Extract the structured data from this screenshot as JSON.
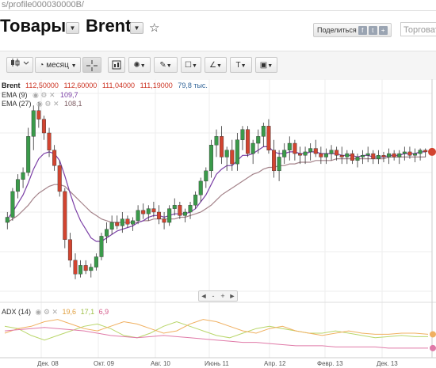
{
  "url": "s/profile000030000B/",
  "header": {
    "section_title": "Товары",
    "instrument": "Brent",
    "share_label": "Поделиться",
    "share_icons": [
      "f",
      "t",
      "+"
    ],
    "search_placeholder": "Торговать"
  },
  "toolbar": {
    "period_label": "месяц",
    "buttons": [
      {
        "name": "chart-type-button",
        "icon": "candles-icon"
      },
      {
        "name": "period-button",
        "icon": "clock-icon"
      },
      {
        "name": "crosshair-button",
        "icon": "crosshair-icon"
      },
      {
        "name": "frame-button",
        "icon": "frame-icon"
      },
      {
        "name": "indicators-button",
        "icon": "sun-icon"
      },
      {
        "name": "draw-line-button",
        "icon": "pencil-icon"
      },
      {
        "name": "shapes-button",
        "icon": "square-icon"
      },
      {
        "name": "fibonacci-button",
        "icon": "angle-icon"
      },
      {
        "name": "text-button",
        "icon": "text-icon"
      },
      {
        "name": "image-button",
        "icon": "image-icon"
      }
    ],
    "text_tool_glyph": "T"
  },
  "legend": {
    "instrument": "Brent",
    "open": "112,50000",
    "high": "112,60000",
    "low": "111,04000",
    "close": "111,19000",
    "volume": "79,8 тыс.",
    "ema1_label": "EMA (9)",
    "ema1_value": "109,7",
    "ema2_label": "EMA (27)",
    "ema2_value": "108,1"
  },
  "adx": {
    "label": "ADX (14)",
    "v1": "19,6",
    "v2": "17,1",
    "v3": "6,9"
  },
  "nav": [
    "◄",
    "-",
    "+",
    "►"
  ],
  "x_axis_labels": [
    "Дек. 08",
    "Окт. 09",
    "Авг. 10",
    "Июнь 11",
    "Апр. 12",
    "Февр. 13",
    "Дек. 13"
  ],
  "colors": {
    "up": "#3a9a4a",
    "down": "#d24430",
    "ema9": "#7b3fa6",
    "ema27": "#a4838a",
    "adx": "#e07aa8",
    "di_plus": "#f0b060",
    "di_minus": "#b9d66a",
    "legend_red": "#cc3322",
    "legend_blue": "#336699"
  },
  "chart_data": {
    "type": "candlestick",
    "title": "Brent",
    "xlabel": "",
    "ylabel": "",
    "candles": [
      [
        70,
        76,
        66,
        73
      ],
      [
        73,
        90,
        71,
        88
      ],
      [
        88,
        98,
        84,
        95
      ],
      [
        95,
        102,
        90,
        99
      ],
      [
        99,
        125,
        97,
        120
      ],
      [
        120,
        138,
        112,
        135
      ],
      [
        135,
        140,
        125,
        130
      ],
      [
        130,
        132,
        118,
        122
      ],
      [
        122,
        125,
        108,
        112
      ],
      [
        112,
        115,
        100,
        103
      ],
      [
        103,
        106,
        85,
        88
      ],
      [
        88,
        90,
        55,
        60
      ],
      [
        60,
        64,
        44,
        48
      ],
      [
        48,
        52,
        37,
        40
      ],
      [
        40,
        48,
        38,
        45
      ],
      [
        45,
        48,
        40,
        42
      ],
      [
        42,
        46,
        38,
        44
      ],
      [
        44,
        52,
        42,
        50
      ],
      [
        50,
        64,
        48,
        62
      ],
      [
        62,
        70,
        58,
        66
      ],
      [
        66,
        74,
        63,
        70
      ],
      [
        70,
        74,
        66,
        68
      ],
      [
        68,
        76,
        64,
        72
      ],
      [
        72,
        74,
        67,
        69
      ],
      [
        69,
        73,
        65,
        71
      ],
      [
        71,
        80,
        69,
        77
      ],
      [
        77,
        81,
        72,
        75
      ],
      [
        75,
        80,
        71,
        78
      ],
      [
        78,
        82,
        73,
        76
      ],
      [
        76,
        80,
        69,
        72
      ],
      [
        72,
        76,
        66,
        70
      ],
      [
        70,
        80,
        68,
        78
      ],
      [
        78,
        84,
        74,
        80
      ],
      [
        80,
        82,
        72,
        74
      ],
      [
        74,
        78,
        70,
        76
      ],
      [
        76,
        82,
        72,
        80
      ],
      [
        80,
        88,
        78,
        86
      ],
      [
        86,
        96,
        82,
        94
      ],
      [
        94,
        102,
        90,
        100
      ],
      [
        100,
        118,
        96,
        115
      ],
      [
        115,
        124,
        108,
        120
      ],
      [
        120,
        126,
        104,
        108
      ],
      [
        108,
        114,
        100,
        112
      ],
      [
        112,
        118,
        100,
        104
      ],
      [
        104,
        122,
        100,
        118
      ],
      [
        118,
        126,
        112,
        124
      ],
      [
        124,
        126,
        108,
        110
      ],
      [
        110,
        118,
        104,
        116
      ],
      [
        116,
        124,
        110,
        120
      ],
      [
        120,
        128,
        114,
        126
      ],
      [
        126,
        130,
        110,
        112
      ],
      [
        112,
        118,
        96,
        100
      ],
      [
        100,
        112,
        94,
        108
      ],
      [
        108,
        116,
        104,
        112
      ],
      [
        112,
        120,
        106,
        116
      ],
      [
        116,
        118,
        106,
        110
      ],
      [
        110,
        114,
        104,
        109
      ],
      [
        109,
        114,
        104,
        111
      ],
      [
        111,
        116,
        106,
        113
      ],
      [
        113,
        118,
        108,
        110
      ],
      [
        110,
        114,
        104,
        108
      ],
      [
        108,
        113,
        104,
        110
      ],
      [
        110,
        115,
        106,
        112
      ],
      [
        112,
        114,
        106,
        109
      ],
      [
        109,
        114,
        104,
        108
      ],
      [
        108,
        112,
        104,
        110
      ],
      [
        110,
        112,
        104,
        106
      ],
      [
        106,
        110,
        102,
        108
      ],
      [
        108,
        112,
        104,
        109
      ],
      [
        109,
        114,
        105,
        110
      ],
      [
        110,
        112,
        104,
        107
      ],
      [
        107,
        112,
        104,
        109
      ],
      [
        109,
        111,
        105,
        108
      ],
      [
        108,
        113,
        104,
        110
      ],
      [
        110,
        112,
        106,
        108
      ],
      [
        108,
        112,
        104,
        110
      ],
      [
        110,
        114,
        106,
        111
      ],
      [
        111,
        114,
        107,
        109
      ],
      [
        109,
        113,
        105,
        110
      ],
      [
        110,
        113,
        106,
        112
      ],
      [
        112,
        113,
        108,
        111
      ]
    ],
    "ema9": [
      72,
      76,
      81,
      86,
      93,
      101,
      107,
      110,
      111,
      110,
      106,
      97,
      87,
      78,
      71,
      66,
      61,
      59,
      59,
      61,
      63,
      65,
      66,
      67,
      68,
      70,
      71,
      73,
      74,
      74,
      73,
      74,
      75,
      75,
      75,
      76,
      78,
      82,
      86,
      92,
      98,
      101,
      103,
      103,
      106,
      109,
      109,
      110,
      112,
      114,
      114,
      111,
      110,
      110,
      111,
      111,
      110,
      110,
      111,
      111,
      110,
      110,
      110,
      110,
      109,
      109,
      109,
      108,
      109,
      109,
      108,
      108,
      108,
      109,
      109,
      109,
      110,
      110,
      110,
      111,
      111
    ],
    "ema27": [
      70,
      72,
      74,
      77,
      80,
      84,
      87,
      89,
      91,
      92,
      92,
      91,
      88,
      85,
      82,
      79,
      76,
      74,
      72,
      71,
      70,
      70,
      70,
      70,
      70,
      70,
      71,
      71,
      72,
      72,
      72,
      72,
      72,
      73,
      73,
      74,
      75,
      76,
      78,
      80,
      83,
      86,
      88,
      90,
      92,
      94,
      96,
      98,
      99,
      101,
      102,
      102,
      103,
      103,
      104,
      104,
      105,
      105,
      105,
      106,
      106,
      106,
      106,
      107,
      107,
      107,
      107,
      107,
      107,
      107,
      107,
      107,
      107,
      108,
      108,
      108,
      108,
      108,
      108,
      108,
      108
    ],
    "adx": [
      22,
      23,
      24,
      25,
      24,
      23,
      22,
      20,
      18,
      17,
      16,
      17,
      18,
      17,
      16,
      15,
      14,
      13,
      12,
      12,
      11,
      10,
      9,
      9,
      9,
      8,
      8,
      8,
      8,
      7,
      7,
      7,
      7
    ],
    "di_plus": [
      20,
      24,
      26,
      30,
      32,
      28,
      24,
      22,
      26,
      30,
      28,
      24,
      20,
      22,
      28,
      32,
      30,
      26,
      22,
      20,
      24,
      26,
      22,
      20,
      18,
      20,
      22,
      20,
      19,
      19,
      20,
      20,
      19
    ],
    "di_minus": [
      26,
      24,
      18,
      14,
      18,
      22,
      26,
      28,
      24,
      18,
      16,
      20,
      26,
      30,
      26,
      22,
      18,
      16,
      20,
      24,
      26,
      24,
      22,
      20,
      20,
      22,
      20,
      18,
      16,
      17,
      18,
      17,
      17
    ]
  }
}
